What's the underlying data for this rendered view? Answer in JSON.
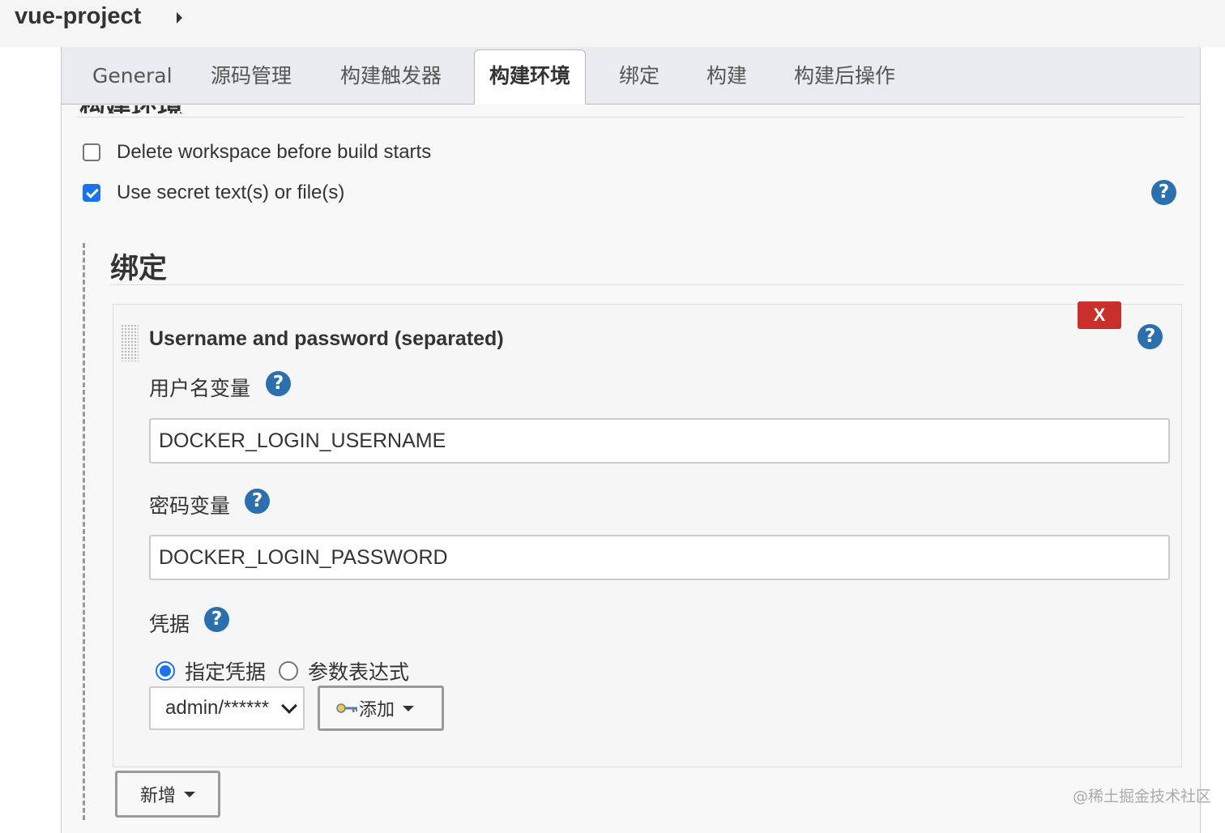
{
  "breadcrumb": {
    "project": "vue-project"
  },
  "tabs": [
    {
      "label": "General"
    },
    {
      "label": "源码管理"
    },
    {
      "label": "构建触发器"
    },
    {
      "label": "构建环境"
    },
    {
      "label": "绑定"
    },
    {
      "label": "构建"
    },
    {
      "label": "构建后操作"
    }
  ],
  "active_tab": "构建环境",
  "build_env": {
    "section_heading": "构建环境",
    "options": [
      {
        "label": "Delete workspace before build starts",
        "checked": false
      },
      {
        "label": "Use secret text(s) or file(s)",
        "checked": true
      }
    ]
  },
  "bindings": {
    "title": "绑定",
    "card": {
      "title": "Username and password (separated)",
      "delete_label": "X",
      "username_label": "用户名变量",
      "username_value": "DOCKER_LOGIN_USERNAME",
      "password_label": "密码变量",
      "password_value": "DOCKER_LOGIN_PASSWORD",
      "credentials_label": "凭据",
      "radio_specific": "指定凭据",
      "radio_expression": "参数表达式",
      "selected_radio": "指定凭据",
      "credential_selected": "admin/******",
      "add_label": "添加"
    },
    "new_label": "新增"
  },
  "help_icon_text": "?",
  "watermark": "@稀土掘金技术社区",
  "colors": {
    "help": "#2c6fad",
    "delete": "#c9302c",
    "checkbox_checked": "#1a73e8"
  }
}
